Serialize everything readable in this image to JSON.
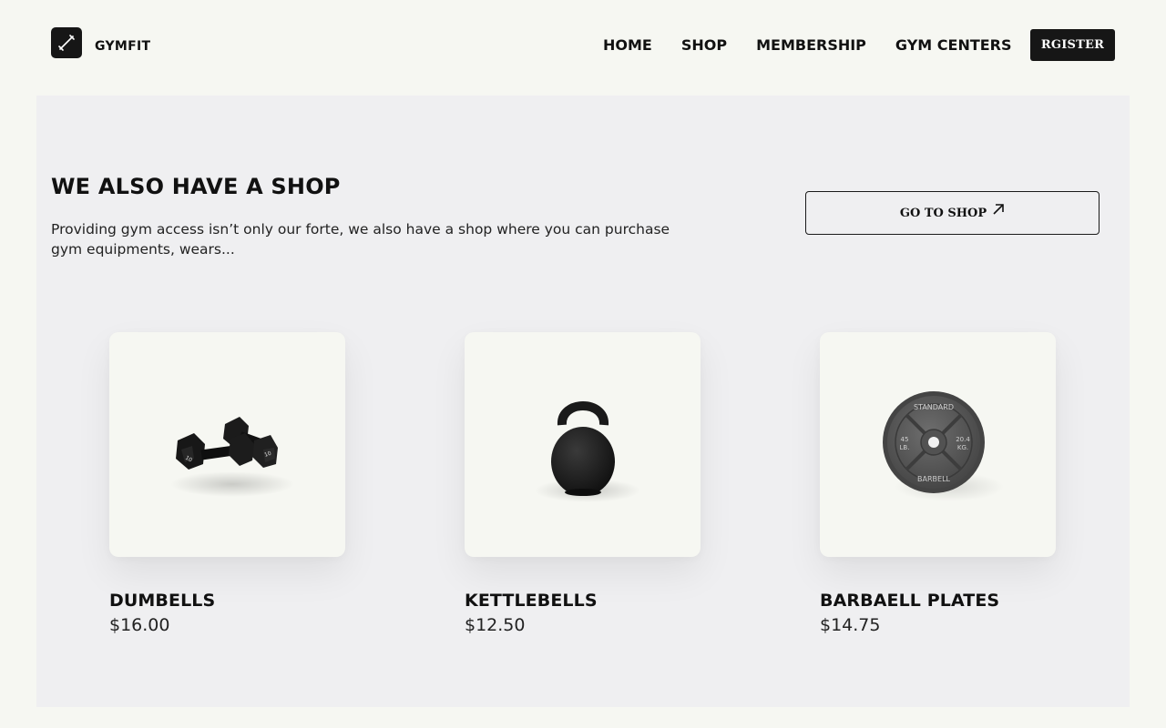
{
  "brand": {
    "name": "GYMFIT",
    "logo_icon": "dumbbell-slash-icon"
  },
  "nav": {
    "items": [
      {
        "label": "HOME"
      },
      {
        "label": "SHOP"
      },
      {
        "label": "MEMBERSHIP"
      },
      {
        "label": "GYM CENTERS"
      }
    ],
    "register_label": "RGISTER"
  },
  "shop_section": {
    "title": "WE ALSO HAVE A SHOP",
    "description": "Providing gym access isn’t only our forte, we also have a shop where you can purchase gym equipments, wears...",
    "cta_label": "GO TO SHOP",
    "cta_icon": "arrow-up-right-icon"
  },
  "products": [
    {
      "name": "DUMBELLS",
      "price": "$16.00",
      "image": "dumbbells-image"
    },
    {
      "name": "KETTLEBELLS",
      "price": "$12.50",
      "image": "kettlebell-image"
    },
    {
      "name": "BARBAELL PLATES",
      "price": "$14.75",
      "image": "barbell-plate-image",
      "plate_text": {
        "top": "STANDARD",
        "bottom": "BARBELL",
        "left1": "45",
        "left2": "LB.",
        "right1": "20.4",
        "right2": "KG."
      }
    }
  ],
  "colors": {
    "page_bg": "#f6f7f2",
    "section_bg": "#efeff1",
    "dark": "#161616"
  }
}
